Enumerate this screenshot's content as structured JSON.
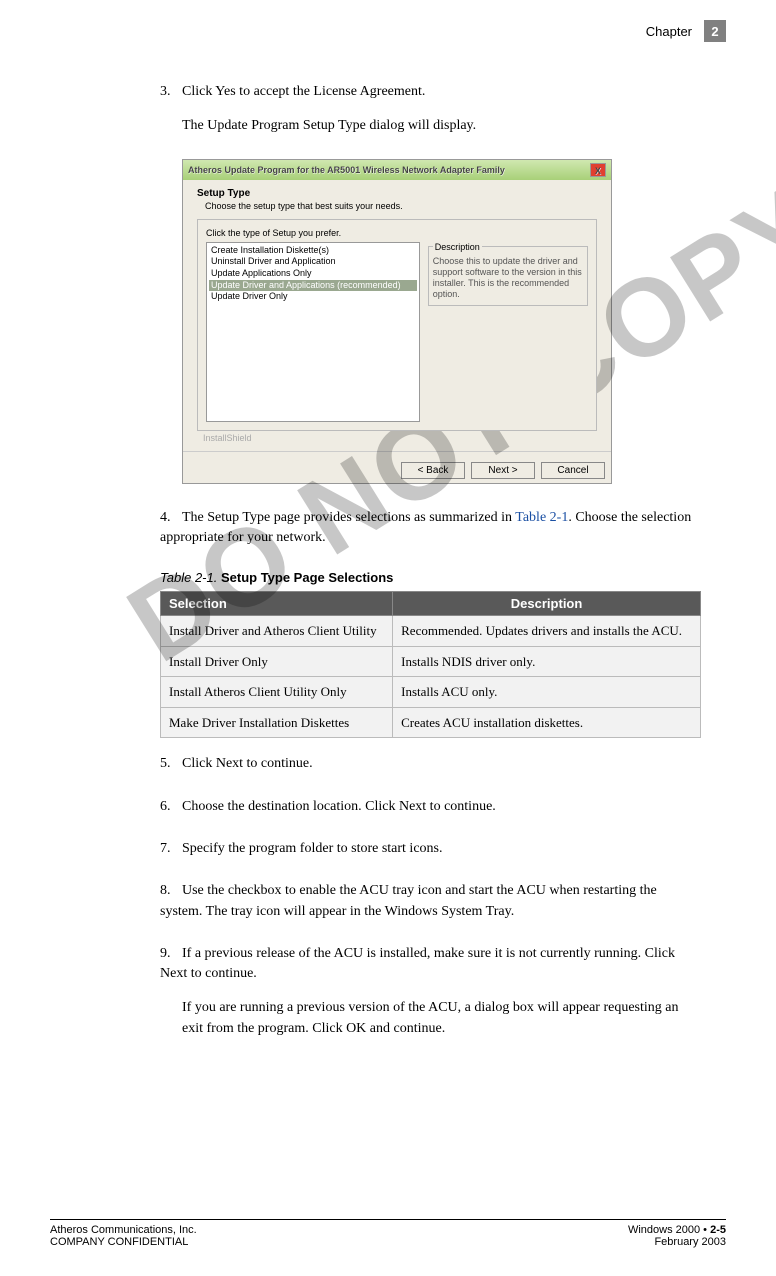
{
  "header": {
    "chapter_label": "Chapter",
    "chapter_num": "2"
  },
  "steps": {
    "s3": {
      "num": "3.",
      "text": "Click Yes to accept the License Agreement.",
      "sub": "The Update Program Setup Type dialog will display."
    },
    "s4": {
      "num": "4.",
      "text_a": "The Setup Type page provides selections as summarized in ",
      "ref": "Table 2-1",
      "text_b": ". Choose the selection appropriate for your network."
    },
    "s5": {
      "num": "5.",
      "text": "Click Next to continue."
    },
    "s6": {
      "num": "6.",
      "text": "Choose the destination location. Click Next to continue."
    },
    "s7": {
      "num": "7.",
      "text": "Specify the program folder to store start icons."
    },
    "s8": {
      "num": "8.",
      "text": "Use the checkbox to enable the ACU tray icon and start the ACU when restarting the system. The tray icon will appear in the Windows System Tray."
    },
    "s9": {
      "num": "9.",
      "text": "If a previous release of the ACU is installed, make sure it is not currently running. Click Next to continue.",
      "sub": "If you are running a previous version of the ACU, a dialog box will appear requesting an exit from the program. Click OK and continue."
    }
  },
  "dialog": {
    "title": "Atheros Update Program for the AR5001 Wireless Network Adapter Family",
    "close": "X",
    "setup_label": "Setup Type",
    "setup_sub": "Choose the setup type that best suits your needs.",
    "panel_label": "Click the type of Setup you prefer.",
    "options": {
      "o1": "Create Installation Diskette(s)",
      "o2": "Uninstall Driver and Application",
      "o3": "Update Applications Only",
      "o4": "Update Driver and Applications (recommended)",
      "o5": "Update Driver Only"
    },
    "desc_legend": "Description",
    "desc_text": "Choose this to update the driver and support software to the version in this installer.  This is the recommended option.",
    "installshield": "InstallShield",
    "btn_back": "< Back",
    "btn_next": "Next >",
    "btn_cancel": "Cancel"
  },
  "table": {
    "caption_prefix": "Table 2-1.",
    "caption_title": "Setup Type Page Selections",
    "head_sel": "Selection",
    "head_desc": "Description",
    "rows": {
      "r1s": "Install Driver and Atheros Client Utility",
      "r1d": "Recommended. Updates drivers and installs the ACU.",
      "r2s": "Install Driver Only",
      "r2d": "Installs NDIS driver only.",
      "r3s": "Install Atheros Client Utility Only",
      "r3d": "Installs ACU only.",
      "r4s": "Make Driver Installation Diskettes",
      "r4d": "Creates ACU installation diskettes."
    }
  },
  "watermark": "DO NOT COPY",
  "footer": {
    "l1": "Atheros Communications, Inc.",
    "l2": "COMPANY CONFIDENTIAL",
    "r1a": "Windows 2000   •   ",
    "r1b": "2-5",
    "r2": "February 2003"
  }
}
